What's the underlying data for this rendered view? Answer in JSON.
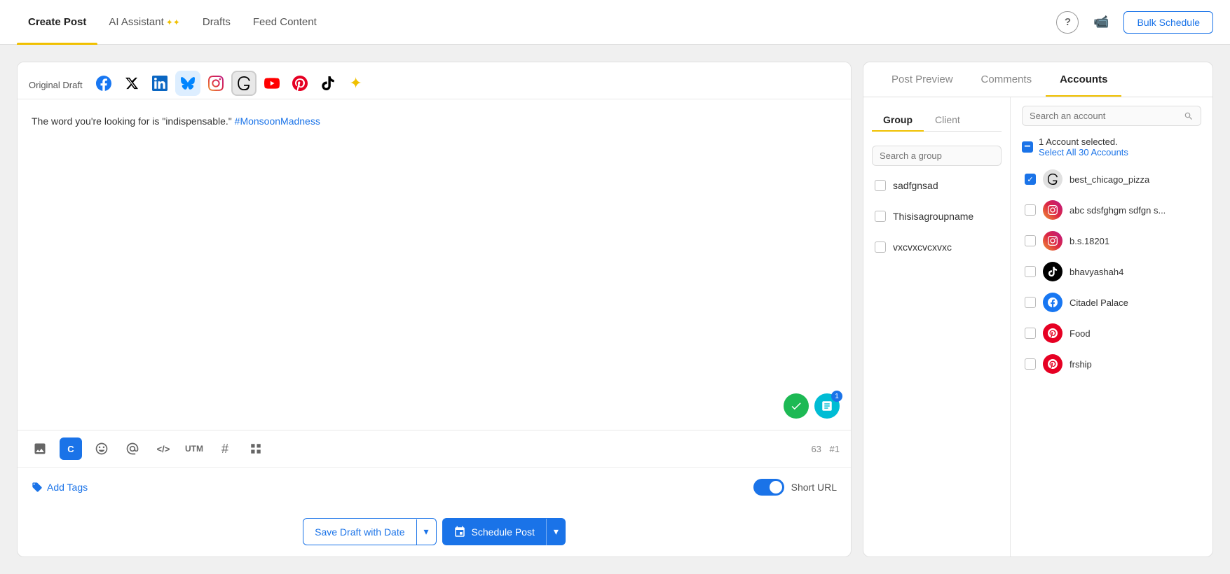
{
  "nav": {
    "tabs": [
      {
        "id": "create-post",
        "label": "Create Post",
        "active": true
      },
      {
        "id": "ai-assistant",
        "label": "AI Assistant",
        "active": false,
        "star": true
      },
      {
        "id": "drafts",
        "label": "Drafts",
        "active": false
      },
      {
        "id": "feed-content",
        "label": "Feed Content",
        "active": false
      }
    ],
    "bulk_schedule_label": "Bulk Schedule"
  },
  "editor": {
    "original_draft_label": "Original Draft",
    "platforms": [
      {
        "id": "facebook",
        "symbol": "f",
        "label": "Facebook"
      },
      {
        "id": "twitter",
        "symbol": "𝕏",
        "label": "Twitter/X"
      },
      {
        "id": "linkedin",
        "symbol": "in",
        "label": "LinkedIn"
      },
      {
        "id": "bluesky",
        "symbol": "🦋",
        "label": "Bluesky"
      },
      {
        "id": "instagram",
        "symbol": "📷",
        "label": "Instagram"
      },
      {
        "id": "threads",
        "symbol": "@",
        "label": "Threads",
        "active": true
      },
      {
        "id": "youtube",
        "symbol": "▶",
        "label": "YouTube"
      },
      {
        "id": "pinterest",
        "symbol": "P",
        "label": "Pinterest"
      },
      {
        "id": "tiktok",
        "symbol": "♪",
        "label": "TikTok"
      },
      {
        "id": "ai",
        "symbol": "✦",
        "label": "AI"
      }
    ],
    "post_text": "The word you're looking for is \"indispensable.\" ",
    "hashtag": "#MonsoonMadness",
    "char_count": "63",
    "hash_count": "#1",
    "toolbar": {
      "image_icon": "🖼",
      "c_icon": "C",
      "emoji_icon": "☺",
      "person_icon": "👤",
      "code_icon": "</>",
      "utm_label": "UTM",
      "hashtag_icon": "#",
      "grid_icon": "⊞"
    },
    "add_tags_label": "Add Tags",
    "short_url_label": "Short URL",
    "short_url_enabled": true,
    "overlay_badge": "1",
    "save_draft_label": "Save Draft with Date",
    "schedule_post_label": "Schedule Post"
  },
  "right_panel": {
    "tabs": [
      {
        "id": "post-preview",
        "label": "Post Preview"
      },
      {
        "id": "comments",
        "label": "Comments"
      },
      {
        "id": "accounts",
        "label": "Accounts",
        "active": true
      }
    ],
    "group_tabs": [
      {
        "id": "group",
        "label": "Group",
        "active": true
      },
      {
        "id": "client",
        "label": "Client"
      }
    ],
    "search_group_placeholder": "Search a group",
    "search_account_placeholder": "Search an account",
    "groups": [
      {
        "id": "sadfgnsad",
        "name": "sadfgnsad",
        "checked": false
      },
      {
        "id": "thisisagroupname",
        "name": "Thisisagroupname",
        "checked": false
      },
      {
        "id": "vxcvxcvcxvxc",
        "name": "vxcvxcvcxvxc",
        "checked": false
      }
    ],
    "selected_count_text": "1 Account selected.",
    "select_all_label": "Select All 30 Accounts",
    "accounts": [
      {
        "id": "best_chicago_pizza",
        "name": "best_chicago_pizza",
        "platform": "threads",
        "checked": true
      },
      {
        "id": "abc_sdsfghgm",
        "name": "abc sdsfghgm sdfgn s...",
        "platform": "instagram",
        "checked": false
      },
      {
        "id": "bs18201",
        "name": "b.s.18201",
        "platform": "instagram",
        "checked": false
      },
      {
        "id": "bhavyashah4",
        "name": "bhavyashah4",
        "platform": "tiktok",
        "checked": false
      },
      {
        "id": "citadel_palace",
        "name": "Citadel Palace",
        "platform": "facebook",
        "checked": false
      },
      {
        "id": "food",
        "name": "Food",
        "platform": "pinterest",
        "checked": false
      },
      {
        "id": "frship",
        "name": "frship",
        "platform": "pinterest",
        "checked": false
      }
    ]
  }
}
